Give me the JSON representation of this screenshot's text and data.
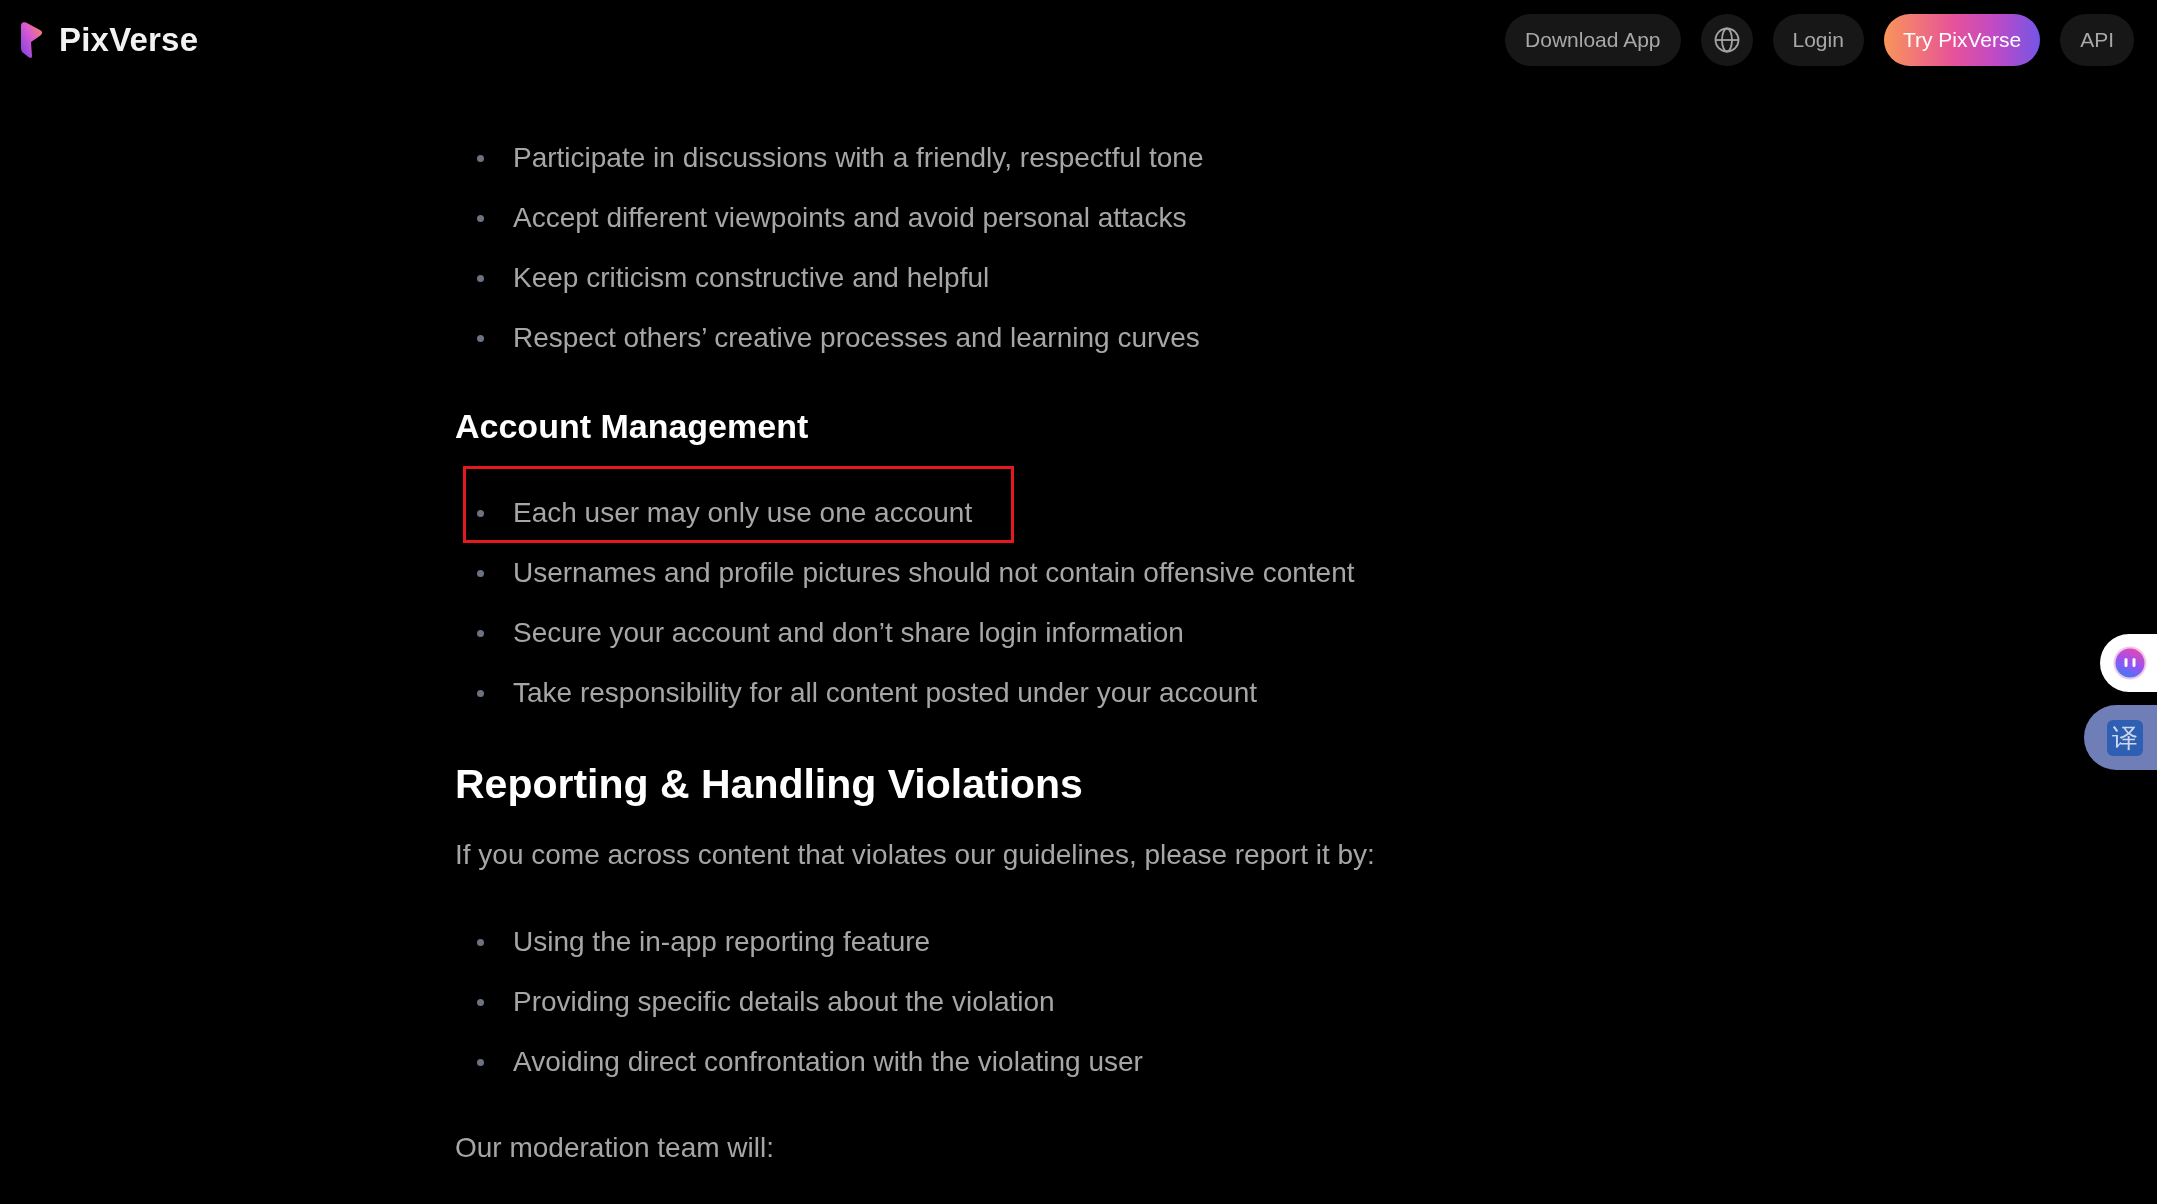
{
  "header": {
    "logo_text": "PixVerse",
    "nav": [
      {
        "kind": "pill",
        "label": "Download App"
      },
      {
        "kind": "globe"
      },
      {
        "kind": "pill",
        "label": "Login"
      },
      {
        "kind": "primary",
        "label": "Try PixVerse"
      },
      {
        "kind": "pill",
        "label": "API"
      }
    ]
  },
  "content": [
    {
      "kind": "list",
      "items": [
        {
          "text": "Participate in discussions with a friendly, respectful tone",
          "highlighted": false
        },
        {
          "text": "Accept different viewpoints and avoid personal attacks",
          "highlighted": false
        },
        {
          "text": "Keep criticism constructive and helpful",
          "highlighted": false
        },
        {
          "text": "Respect others’ creative processes and learning curves",
          "highlighted": false
        }
      ]
    },
    {
      "kind": "heading",
      "text": "Account Management"
    },
    {
      "kind": "list",
      "items": [
        {
          "text": "Each user may only use one account",
          "highlighted": true
        },
        {
          "text": "Usernames and profile pictures should not contain offensive content",
          "highlighted": false
        },
        {
          "text": "Secure your account and don’t share login information",
          "highlighted": false
        },
        {
          "text": "Take responsibility for all content posted under your account",
          "highlighted": false
        }
      ]
    },
    {
      "kind": "title",
      "text": "Reporting & Handling Violations"
    },
    {
      "kind": "paragraph",
      "text": "If you come across content that violates our guidelines, please report it by:"
    },
    {
      "kind": "list",
      "items": [
        {
          "text": "Using the in-app reporting feature",
          "highlighted": false
        },
        {
          "text": "Providing specific details about the violation",
          "highlighted": false
        },
        {
          "text": "Avoiding direct confrontation with the violating user",
          "highlighted": false
        }
      ]
    },
    {
      "kind": "paragraph",
      "text": "Our moderation team will:"
    }
  ],
  "side_widgets": [
    {
      "kind": "assistant"
    },
    {
      "kind": "translate",
      "label": "译"
    }
  ]
}
